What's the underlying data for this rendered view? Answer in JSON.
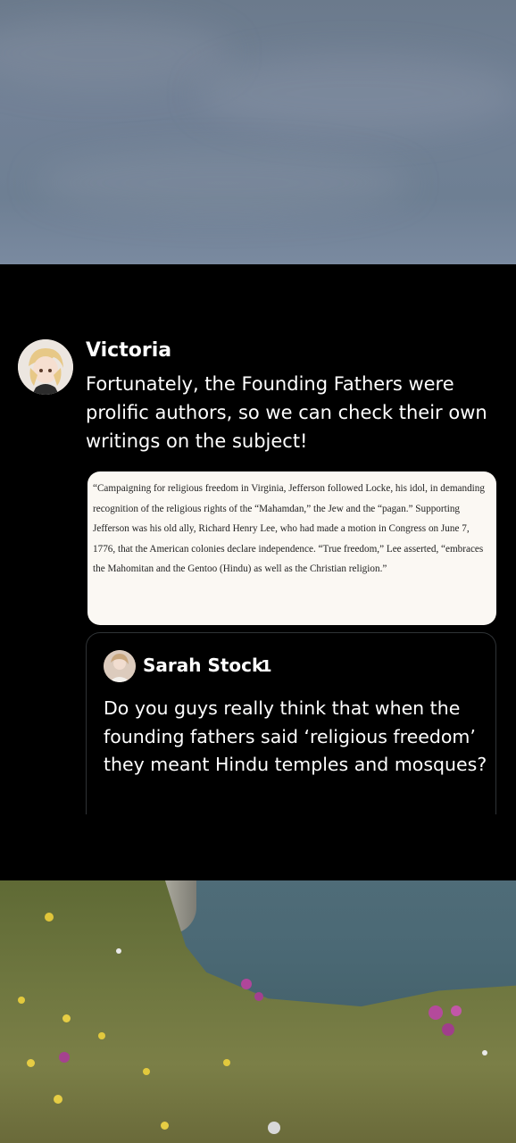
{
  "post": {
    "author": "Victoria",
    "text": "Fortunately, the Founding Fathers were prolific authors, so we can check their own writings on the subject!",
    "quote_excerpt": "“Campaigning for religious freedom in Virginia, Jefferson followed Locke, his idol, in demanding recognition of the religious rights of the “Mahamdan,” the Jew and the “pagan.” Supporting Jefferson was his old ally, Richard Henry Lee, who had made a motion in Congress on June 7, 1776, that the American colonies declare independence. “True freedom,” Lee asserted, “embraces the Mahomitan and the Gentoo (Hindu) as well as the Christian religion.”"
  },
  "quoted_tweet": {
    "author": "Sarah Stock",
    "badge": "1",
    "text": "Do you guys really think that when the founding fathers said ‘religious freedom’ they meant Hindu temples and mosques?"
  },
  "colors": {
    "background": "#000000",
    "text": "#ffffff",
    "quote_card": "#fbf8f3",
    "quoted_border": "#2f3336"
  }
}
